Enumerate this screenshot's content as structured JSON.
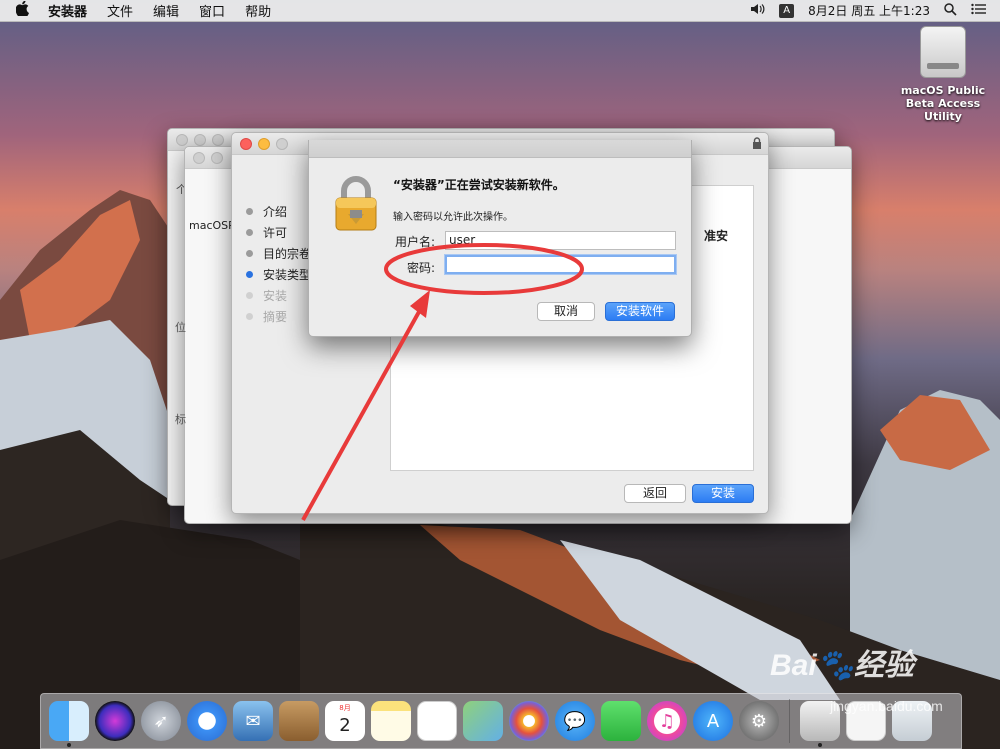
{
  "menubar": {
    "app_name": "安装器",
    "items": [
      "文件",
      "编辑",
      "窗口",
      "帮助"
    ],
    "input_indicator": "A",
    "clock": "8月2日 周五 上午1:23"
  },
  "desktop": {
    "drive_label": "macOS Public Beta Access Utility"
  },
  "installer": {
    "steps": [
      {
        "label": "介绍",
        "state": "done"
      },
      {
        "label": "许可",
        "state": "done"
      },
      {
        "label": "目的宗卷",
        "state": "done"
      },
      {
        "label": "安装类型",
        "state": "active"
      },
      {
        "label": "安装",
        "state": "pending"
      },
      {
        "label": "摘要",
        "state": "pending"
      }
    ],
    "back_button": "返回",
    "install_button": "安装",
    "peek_text": "准安"
  },
  "back_window": {
    "item_label": "macOSP",
    "label_wei": "位",
    "label_biao": "标",
    "label_ge": "个"
  },
  "auth_dialog": {
    "title": "“安装器”正在尝试安装新软件。",
    "subtitle": "输入密码以允许此次操作。",
    "username_label": "用户名:",
    "username_value": "user",
    "password_label": "密码:",
    "password_value": "",
    "cancel_button": "取消",
    "confirm_button": "安装软件"
  },
  "dock": {
    "apps": [
      "finder-icon",
      "siri-icon",
      "launchpad-icon",
      "safari-icon",
      "mail-icon",
      "contacts-icon",
      "calendar-icon",
      "notes-icon",
      "reminders-icon",
      "maps-icon",
      "photos-icon",
      "messages-icon",
      "facetime-icon",
      "itunes-icon",
      "appstore-icon",
      "system-preferences-icon"
    ],
    "calendar_month": "8月",
    "calendar_day": "2"
  },
  "watermark": {
    "brand": "Bai🐾经验",
    "url": "jingyan.baidu.com"
  },
  "colors": {
    "accent_blue": "#2c7cf3",
    "annotation_red": "#e83a3a"
  }
}
